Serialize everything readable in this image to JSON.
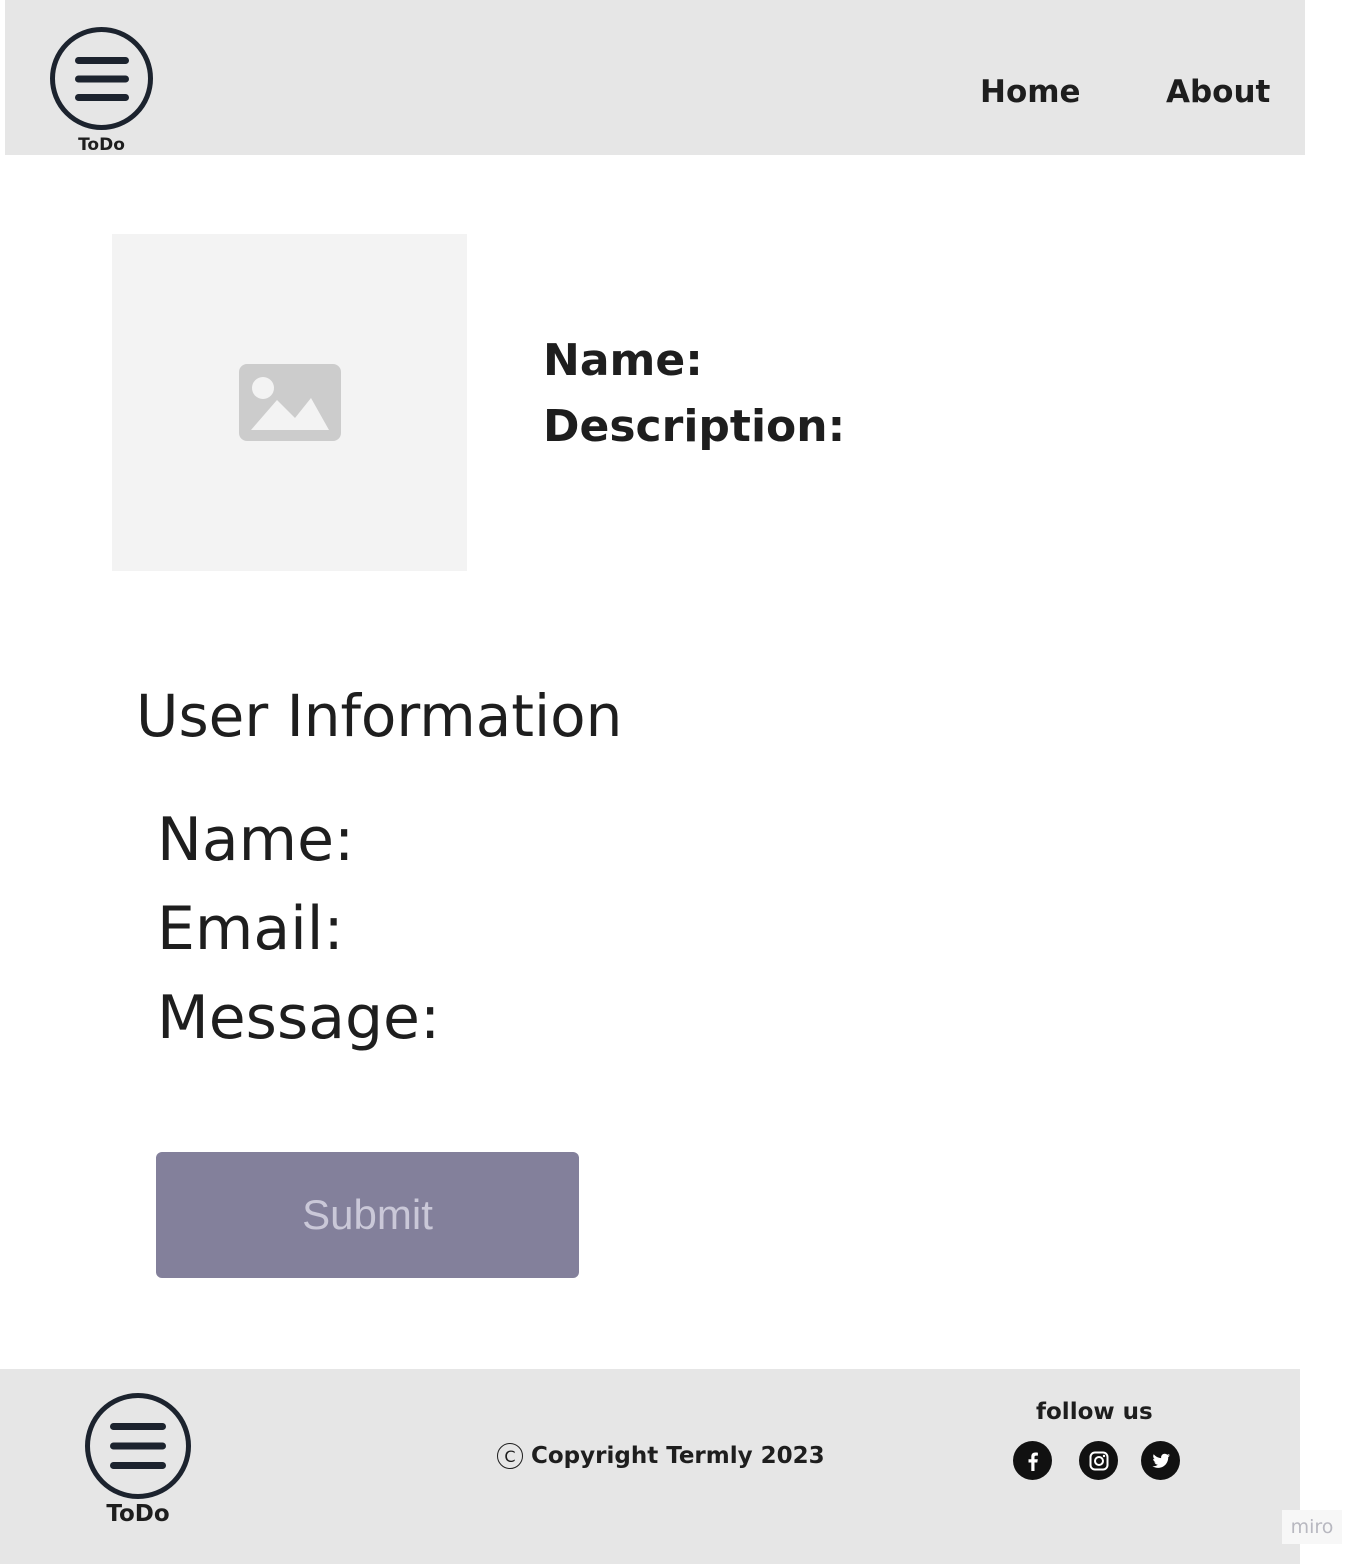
{
  "header": {
    "logo_text": "ToDo",
    "nav": {
      "home": "Home",
      "about": "About"
    }
  },
  "item": {
    "image_icon": "image-placeholder-icon",
    "name_label": "Name:",
    "description_label": "Description:"
  },
  "user_info": {
    "title": "User Information",
    "name_label": "Name:",
    "email_label": "Email:",
    "message_label": "Message:",
    "submit_label": "Submit"
  },
  "footer": {
    "logo_text": "ToDo",
    "copyright_symbol": "C",
    "copyright_text": "Copyright Termly 2023",
    "follow_text": "follow us",
    "social_icons": [
      "facebook-icon",
      "instagram-icon",
      "twitter-icon"
    ]
  },
  "watermark": "miro",
  "colors": {
    "header_bg": "#e6e6e6",
    "button_bg": "#83809b",
    "button_text": "#cac8d8",
    "image_bg": "#f3f3f3",
    "image_icon": "#cccccc",
    "logo_stroke": "#1c232e"
  }
}
